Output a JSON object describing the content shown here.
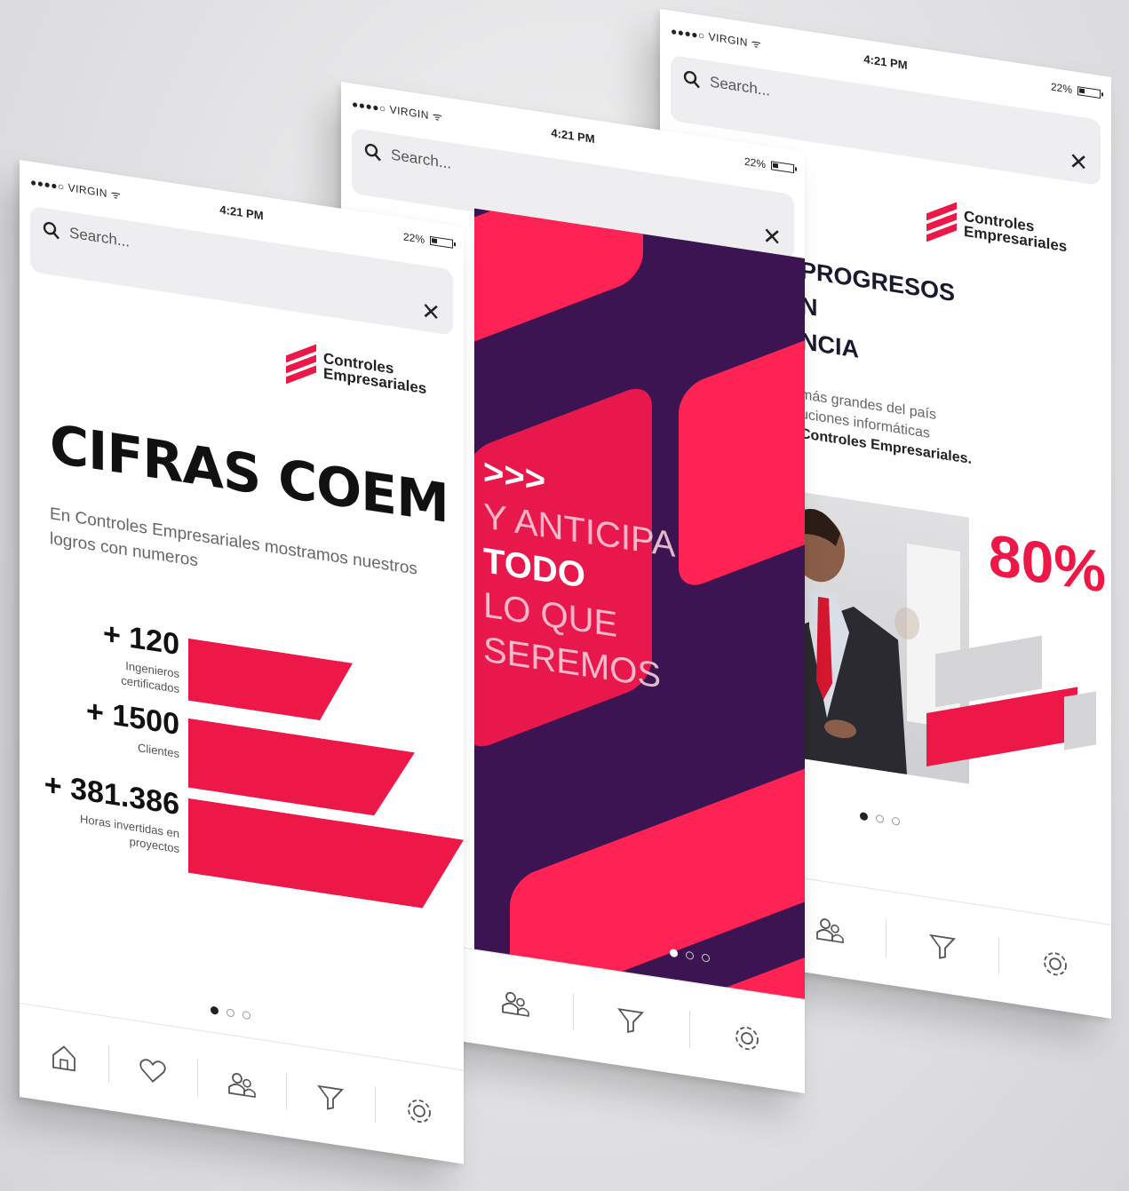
{
  "status": {
    "carrier": "●●●●○ VIRGIN ᯤ",
    "time": "4:21 PM",
    "battery": "22%"
  },
  "search": {
    "placeholder": "Search..."
  },
  "logo": {
    "line1": "Controles",
    "line2": "Empresariales"
  },
  "screen1": {
    "title": "CIFRAS COEM",
    "lead": "En Controles Empresariales mostramos nuestros logros con numeros",
    "stats": [
      {
        "value": "+ 120",
        "label": "Ingenieros certificados"
      },
      {
        "value": "+ 1500",
        "label": "Clientes"
      },
      {
        "value": "+ 381.386",
        "label": "Horas invertidas en proyectos"
      }
    ]
  },
  "screen2": {
    "arrows": ">>>",
    "line1": "Y ANTICIPA",
    "line2": "TODO",
    "line3": "LO QUE",
    "line4": "SEREMOS"
  },
  "screen3": {
    "title_lines": [
      "PROGRESOS",
      "N",
      "NCIA"
    ],
    "para_lines": [
      "más grandes del país",
      "uciones informáticas"
    ],
    "para_bold": "Controles Empresariales.",
    "percent": "80%"
  },
  "colors": {
    "accent": "#ee1848",
    "purple": "#3d1452"
  },
  "tabs": [
    "home-icon",
    "heart-icon",
    "users-icon",
    "filter-icon",
    "settings-icon"
  ]
}
